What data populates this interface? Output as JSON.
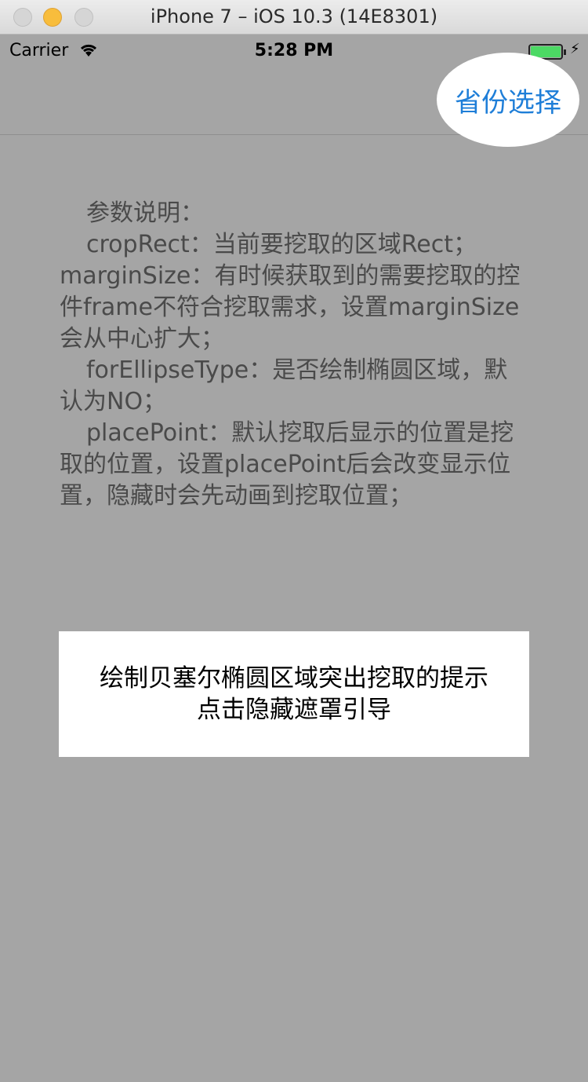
{
  "window": {
    "title": "iPhone 7 – iOS 10.3 (14E8301)"
  },
  "status_bar": {
    "carrier": "Carrier",
    "time": "5:28 PM",
    "battery_level": 1.0
  },
  "nav": {
    "right_button_label": "省份选择"
  },
  "description": {
    "lines": [
      "参数说明：",
      "cropRect：当前要挖取的区域Rect；marginSize：有时候获取到的需要挖取的控件frame不符合挖取需求，设置marginSize会从中心扩大；",
      "forEllipseType：是否绘制椭圆区域，默认为NO；",
      "placePoint：默认挖取后显示的位置是挖取的位置，设置placePoint后会改变显示位置，隐藏时会先动画到挖取位置；"
    ]
  },
  "tip": {
    "line1": "绘制贝塞尔椭圆区域突出挖取的提示",
    "line2": "点击隐藏遮罩引导"
  },
  "colors": {
    "overlay": "#a5a5a5",
    "accent": "#1e7ed8",
    "battery": "#4cd964"
  }
}
